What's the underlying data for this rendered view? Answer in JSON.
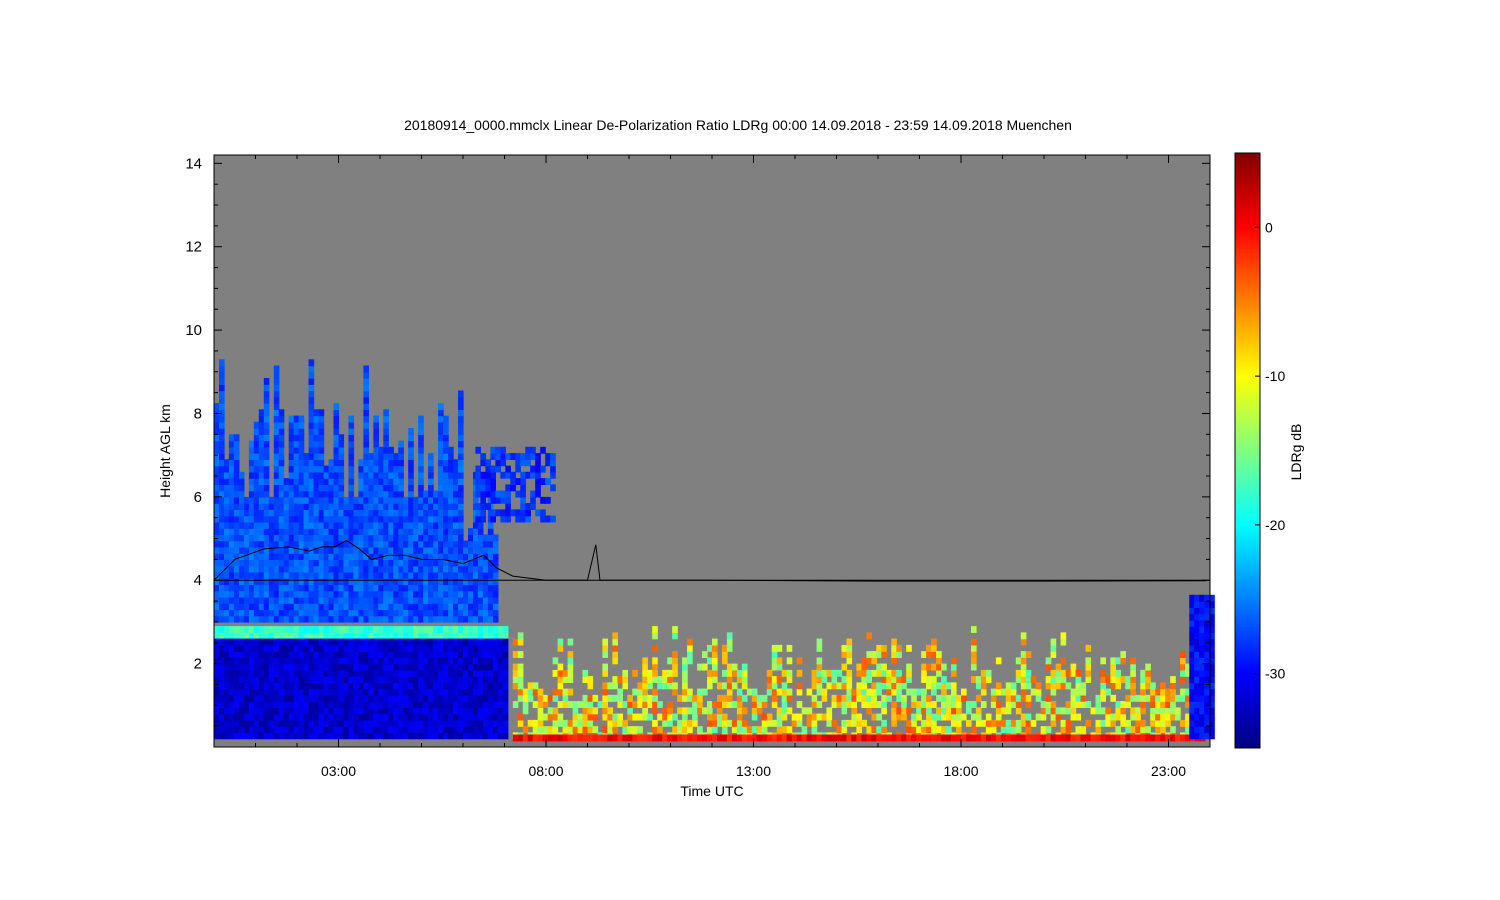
{
  "chart_data": {
    "type": "heatmap",
    "title": "20180914_0000.mmclx Linear De-Polarization Ratio LDRg   00:00 14.09.2018 - 23:59 14.09.2018 Muenchen",
    "xlabel": "Time UTC",
    "ylabel": "Height AGL km",
    "colorbar_label": "LDRg dB",
    "x_range_hours": [
      0,
      24
    ],
    "y_range_km": [
      0,
      14.2
    ],
    "x_ticks": [
      {
        "hour": 3,
        "label": "03:00"
      },
      {
        "hour": 8,
        "label": "08:00"
      },
      {
        "hour": 13,
        "label": "13:00"
      },
      {
        "hour": 18,
        "label": "18:00"
      },
      {
        "hour": 23,
        "label": "23:00"
      }
    ],
    "y_ticks": [
      {
        "km": 2,
        "label": "2"
      },
      {
        "km": 4,
        "label": "4"
      },
      {
        "km": 6,
        "label": "6"
      },
      {
        "km": 8,
        "label": "8"
      },
      {
        "km": 10,
        "label": "10"
      },
      {
        "km": 12,
        "label": "12"
      },
      {
        "km": 14,
        "label": "14"
      }
    ],
    "colorbar_range_db": [
      -35,
      5
    ],
    "colorbar_ticks": [
      {
        "db": 0,
        "label": "0"
      },
      {
        "db": -10,
        "label": "-10"
      },
      {
        "db": -20,
        "label": "-20"
      },
      {
        "db": -30,
        "label": "-30"
      }
    ],
    "colormap": [
      "#000080",
      "#0000ff",
      "#0080ff",
      "#00ffff",
      "#80ff80",
      "#ffff00",
      "#ff8000",
      "#ff0000",
      "#800000"
    ],
    "background_color": "#808080",
    "reference_line_km": 4.0,
    "black_line_series": [
      [
        0.0,
        4.0
      ],
      [
        0.5,
        4.5
      ],
      [
        1.2,
        4.75
      ],
      [
        1.8,
        4.8
      ],
      [
        2.3,
        4.7
      ],
      [
        2.6,
        4.8
      ],
      [
        2.9,
        4.8
      ],
      [
        3.2,
        4.95
      ],
      [
        3.5,
        4.75
      ],
      [
        3.8,
        4.5
      ],
      [
        4.2,
        4.6
      ],
      [
        4.6,
        4.6
      ],
      [
        5.0,
        4.5
      ],
      [
        5.5,
        4.5
      ],
      [
        6.0,
        4.4
      ],
      [
        6.5,
        4.6
      ],
      [
        6.8,
        4.3
      ],
      [
        7.2,
        4.1
      ],
      [
        8.0,
        4.0
      ],
      [
        9.0,
        4.0
      ],
      [
        9.2,
        4.85
      ],
      [
        9.3,
        4.0
      ],
      [
        12.0,
        4.0
      ],
      [
        16.0,
        3.98
      ],
      [
        20.0,
        3.98
      ],
      [
        23.9,
        3.99
      ]
    ],
    "regions": [
      {
        "name": "ice-cloud",
        "t": [
          0,
          6.8
        ],
        "h": [
          3.0,
          9.3
        ],
        "ldr_db": -27
      },
      {
        "name": "melting-layer",
        "t": [
          0,
          7.0
        ],
        "h": [
          2.45,
          2.85
        ],
        "ldr_db": -18
      },
      {
        "name": "rain",
        "t": [
          0,
          7.0
        ],
        "h": [
          0.2,
          2.45
        ],
        "ldr_db": -32
      },
      {
        "name": "isolated-cloud",
        "t": [
          6.3,
          8.2
        ],
        "h": [
          5.4,
          7.2
        ],
        "ldr_db": -28
      },
      {
        "name": "boundary-layer-echoes",
        "t": [
          7.2,
          23.8
        ],
        "h": [
          0.2,
          2.8
        ],
        "ldr_db": -10
      },
      {
        "name": "surface-clutter",
        "t": [
          7.2,
          23.8
        ],
        "h": [
          0.15,
          0.3
        ],
        "ldr_db": 0
      },
      {
        "name": "late-rain",
        "t": [
          23.5,
          24.0
        ],
        "h": [
          0.2,
          3.5
        ],
        "ldr_db": -30
      }
    ]
  }
}
